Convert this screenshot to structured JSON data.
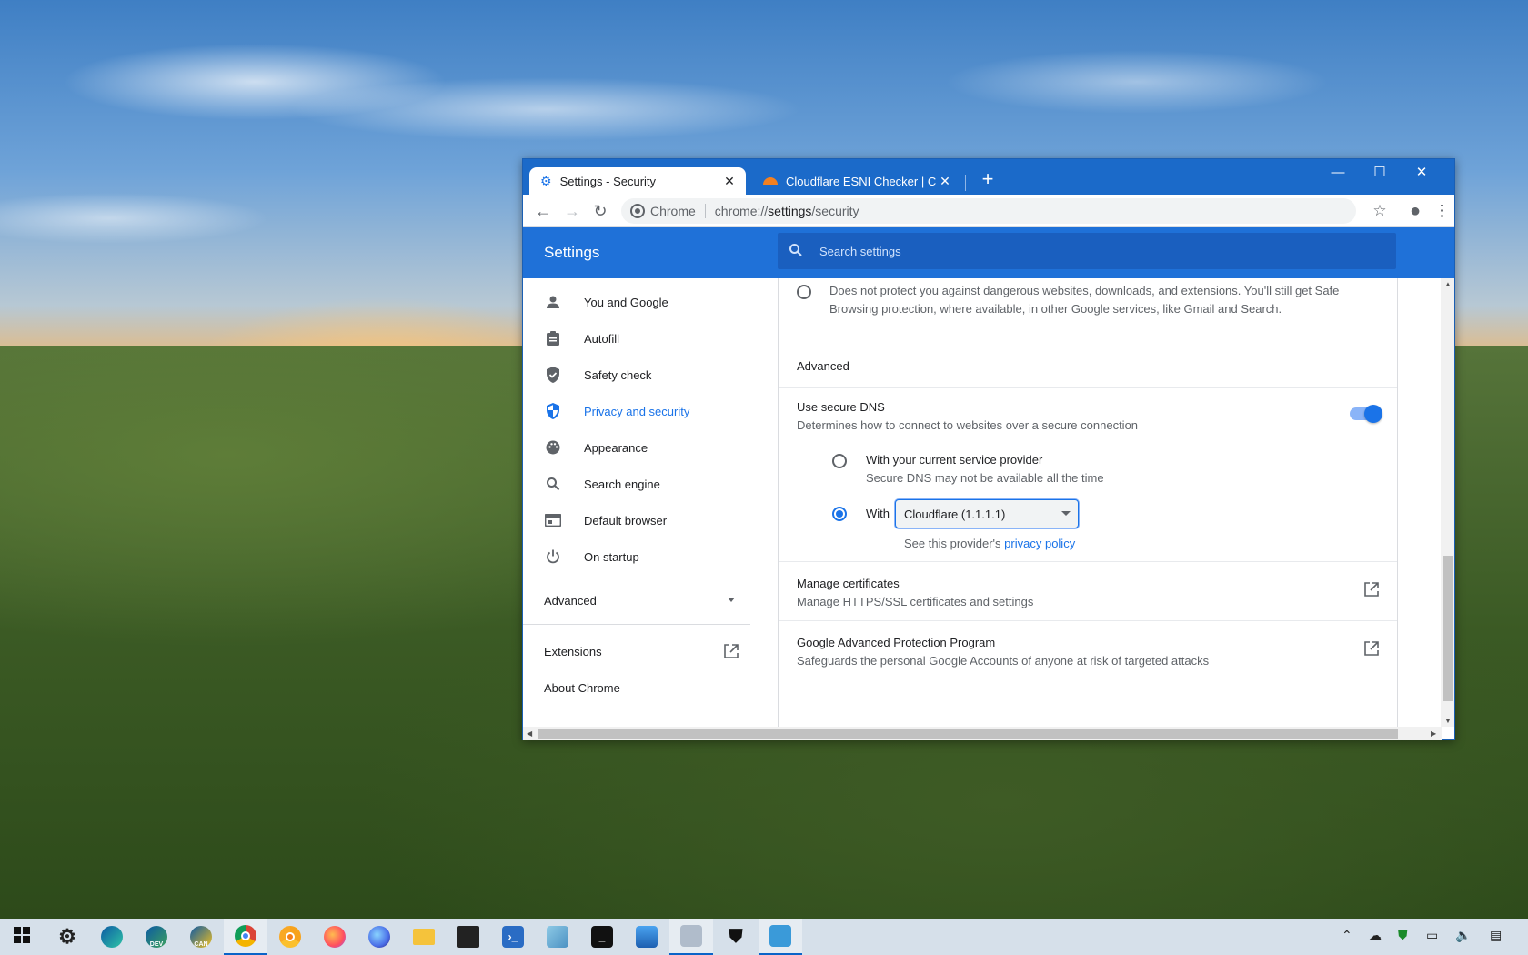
{
  "browser": {
    "tabs": [
      {
        "title": "Settings - Security",
        "icon": "gear-icon",
        "active": true
      },
      {
        "title": "Cloudflare ESNI Checker | Cloudf",
        "icon": "cloudflare-icon",
        "active": false
      }
    ],
    "omnibox": {
      "chip": "Chrome",
      "url_host": "chrome://",
      "url_rest": "settings",
      "url_tail": "/security"
    }
  },
  "settings": {
    "title": "Settings",
    "search_placeholder": "Search settings",
    "nav": [
      {
        "label": "You and Google",
        "icon": "person-icon"
      },
      {
        "label": "Autofill",
        "icon": "clipboard-icon"
      },
      {
        "label": "Safety check",
        "icon": "shield-check-icon"
      },
      {
        "label": "Privacy and security",
        "icon": "shield-icon",
        "active": true
      },
      {
        "label": "Appearance",
        "icon": "palette-icon"
      },
      {
        "label": "Search engine",
        "icon": "search-icon"
      },
      {
        "label": "Default browser",
        "icon": "browser-icon"
      },
      {
        "label": "On startup",
        "icon": "power-icon"
      }
    ],
    "advanced_label": "Advanced",
    "extensions_label": "Extensions",
    "about_label": "About Chrome",
    "no_protection_desc_1": "Does not protect you against dangerous websites, downloads, and extensions. You'll still get Safe",
    "no_protection_desc_2": "Browsing protection, where available, in other Google services, like Gmail and Search.",
    "advanced_heading": "Advanced",
    "secure_dns": {
      "title": "Use secure DNS",
      "desc": "Determines how to connect to websites over a secure connection",
      "enabled": true,
      "option1_title": "With your current service provider",
      "option1_desc": "Secure DNS may not be available all the time",
      "option2_label": "With",
      "provider": "Cloudflare (1.1.1.1)",
      "policy_prefix": "See this provider's",
      "policy_link": "privacy policy"
    },
    "certs": {
      "title": "Manage certificates",
      "desc": "Manage HTTPS/SSL certificates and settings"
    },
    "gapp": {
      "title": "Google Advanced Protection Program",
      "desc": "Safeguards the personal Google Accounts of anyone at risk of targeted attacks"
    }
  },
  "taskbar": {
    "items": [
      "start-icon",
      "settings-icon",
      "edge-icon",
      "edge-dev-icon",
      "edge-canary-icon",
      "chrome-icon",
      "chrome-canary-icon",
      "firefox-icon",
      "firefox-nightly-icon",
      "file-explorer-icon",
      "store-icon",
      "powershell-icon",
      "notepad-icon",
      "terminal-icon",
      "photos-icon",
      "snipping-icon",
      "defender-icon",
      "remote-desktop-icon"
    ],
    "badges": {
      "edge-dev-icon": "DEV",
      "edge-canary-icon": "CAN"
    }
  }
}
